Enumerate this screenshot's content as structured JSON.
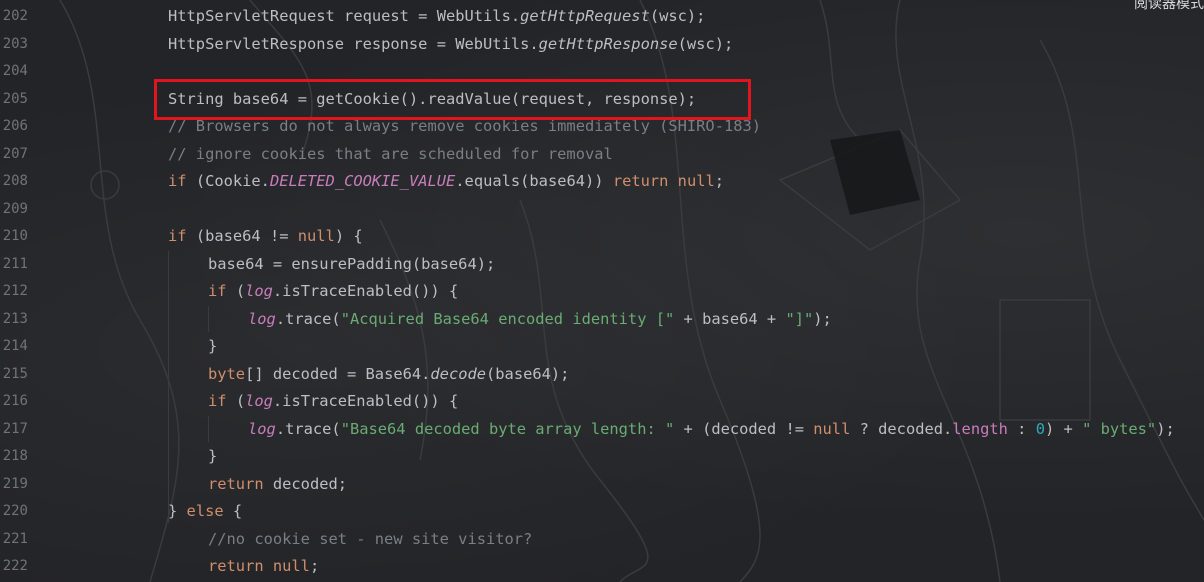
{
  "corner_text": "阅读器模式",
  "lines": [
    {
      "n": "202",
      "indent": 0,
      "segments": [
        {
          "t": "HttpServletRequest request = WebUtils.",
          "c": ""
        },
        {
          "t": "getHttpRequest",
          "c": "sfn"
        },
        {
          "t": "(wsc);",
          "c": ""
        }
      ]
    },
    {
      "n": "203",
      "indent": 0,
      "segments": [
        {
          "t": "HttpServletResponse response = WebUtils.",
          "c": ""
        },
        {
          "t": "getHttpResponse",
          "c": "sfn"
        },
        {
          "t": "(wsc);",
          "c": ""
        }
      ]
    },
    {
      "n": "204",
      "indent": 0,
      "segments": []
    },
    {
      "n": "205",
      "indent": 0,
      "segments": [
        {
          "t": "String base64 = getCookie().readValue(request, response);",
          "c": ""
        }
      ]
    },
    {
      "n": "206",
      "indent": 0,
      "segments": [
        {
          "t": "// Browsers do not always remove cookies immediately (SHIRO-183)",
          "c": "cmt"
        }
      ]
    },
    {
      "n": "207",
      "indent": 0,
      "segments": [
        {
          "t": "// ignore cookies that are scheduled for removal",
          "c": "cmt"
        }
      ]
    },
    {
      "n": "208",
      "indent": 0,
      "segments": [
        {
          "t": "if",
          "c": "kw"
        },
        {
          "t": " (Cookie.",
          "c": ""
        },
        {
          "t": "DELETED_COOKIE_VALUE",
          "c": "fld"
        },
        {
          "t": ".equals(base64)) ",
          "c": ""
        },
        {
          "t": "return null",
          "c": "kw"
        },
        {
          "t": ";",
          "c": ""
        }
      ]
    },
    {
      "n": "209",
      "indent": 0,
      "segments": []
    },
    {
      "n": "210",
      "indent": 0,
      "segments": [
        {
          "t": "if",
          "c": "kw"
        },
        {
          "t": " (base64 != ",
          "c": ""
        },
        {
          "t": "null",
          "c": "kw"
        },
        {
          "t": ") {",
          "c": ""
        }
      ]
    },
    {
      "n": "211",
      "indent": 1,
      "segments": [
        {
          "t": "base64 = ensurePadding(base64);",
          "c": ""
        }
      ]
    },
    {
      "n": "212",
      "indent": 1,
      "segments": [
        {
          "t": "if",
          "c": "kw"
        },
        {
          "t": " (",
          "c": ""
        },
        {
          "t": "log",
          "c": "fld"
        },
        {
          "t": ".isTraceEnabled()) {",
          "c": ""
        }
      ]
    },
    {
      "n": "213",
      "indent": 2,
      "segments": [
        {
          "t": "log",
          "c": "fld"
        },
        {
          "t": ".trace(",
          "c": ""
        },
        {
          "t": "\"Acquired Base64 encoded identity [\"",
          "c": "str"
        },
        {
          "t": " + base64 + ",
          "c": ""
        },
        {
          "t": "\"]\"",
          "c": "str"
        },
        {
          "t": ");",
          "c": ""
        }
      ]
    },
    {
      "n": "214",
      "indent": 1,
      "segments": [
        {
          "t": "}",
          "c": ""
        }
      ]
    },
    {
      "n": "215",
      "indent": 1,
      "segments": [
        {
          "t": "byte",
          "c": "kw"
        },
        {
          "t": "[] decoded = Base64.",
          "c": ""
        },
        {
          "t": "decode",
          "c": "sfn"
        },
        {
          "t": "(base64);",
          "c": ""
        }
      ]
    },
    {
      "n": "216",
      "indent": 1,
      "segments": [
        {
          "t": "if",
          "c": "kw"
        },
        {
          "t": " (",
          "c": ""
        },
        {
          "t": "log",
          "c": "fld"
        },
        {
          "t": ".isTraceEnabled()) {",
          "c": ""
        }
      ]
    },
    {
      "n": "217",
      "indent": 2,
      "segments": [
        {
          "t": "log",
          "c": "fld"
        },
        {
          "t": ".trace(",
          "c": ""
        },
        {
          "t": "\"Base64 decoded byte array length: \"",
          "c": "str"
        },
        {
          "t": " + (decoded != ",
          "c": ""
        },
        {
          "t": "null",
          "c": "kw"
        },
        {
          "t": " ? decoded.",
          "c": ""
        },
        {
          "t": "length",
          "c": "fldp"
        },
        {
          "t": " : ",
          "c": ""
        },
        {
          "t": "0",
          "c": "num"
        },
        {
          "t": ") + ",
          "c": ""
        },
        {
          "t": "\" bytes\"",
          "c": "str"
        },
        {
          "t": ");",
          "c": ""
        }
      ]
    },
    {
      "n": "218",
      "indent": 1,
      "segments": [
        {
          "t": "}",
          "c": ""
        }
      ]
    },
    {
      "n": "219",
      "indent": 1,
      "segments": [
        {
          "t": "return",
          "c": "kw"
        },
        {
          "t": " decoded;",
          "c": ""
        }
      ]
    },
    {
      "n": "220",
      "indent": 0,
      "segments": [
        {
          "t": "} ",
          "c": ""
        },
        {
          "t": "else",
          "c": "kw"
        },
        {
          "t": " {",
          "c": ""
        }
      ]
    },
    {
      "n": "221",
      "indent": 1,
      "segments": [
        {
          "t": "//no cookie set - new site visitor?",
          "c": "cmt"
        }
      ]
    },
    {
      "n": "222",
      "indent": 1,
      "segments": [
        {
          "t": "return null",
          "c": "kw"
        },
        {
          "t": ";",
          "c": ""
        }
      ]
    }
  ]
}
